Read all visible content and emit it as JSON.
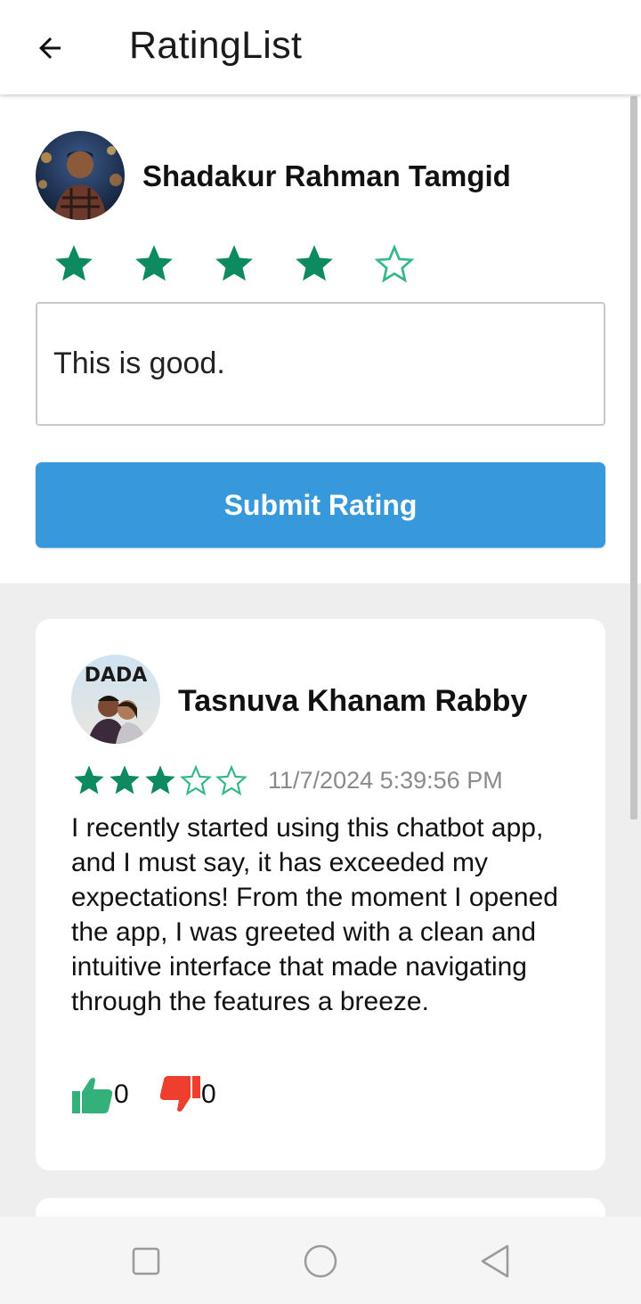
{
  "app_bar": {
    "title": "RatingList",
    "back_icon": "arrow-left-icon"
  },
  "composer": {
    "user_name": "Shadakur Rahman Tamgid",
    "rating": 4,
    "max_rating": 5,
    "comment_value": "This is good.",
    "submit_label": "Submit Rating",
    "star_color": "#0d8a5f",
    "button_color": "#3898dc"
  },
  "reviews": [
    {
      "name": "Tasnuva Khanam Rabby",
      "avatar_text": "DADA",
      "rating": 3,
      "max_rating": 5,
      "date": "11/7/2024 5:39:56 PM",
      "text": "I recently started using this chatbot app, and I must say, it has exceeded my expectations! From the moment I opened the app, I was greeted with a clean and intuitive interface that made navigating through the features a breeze.",
      "likes": "0",
      "dislikes": "0",
      "like_color": "#34b07a",
      "dislike_color": "#ee3e2e"
    }
  ],
  "nav_bar": {
    "recents_icon": "square-icon",
    "home_icon": "circle-icon",
    "back_icon": "triangle-back-icon"
  }
}
